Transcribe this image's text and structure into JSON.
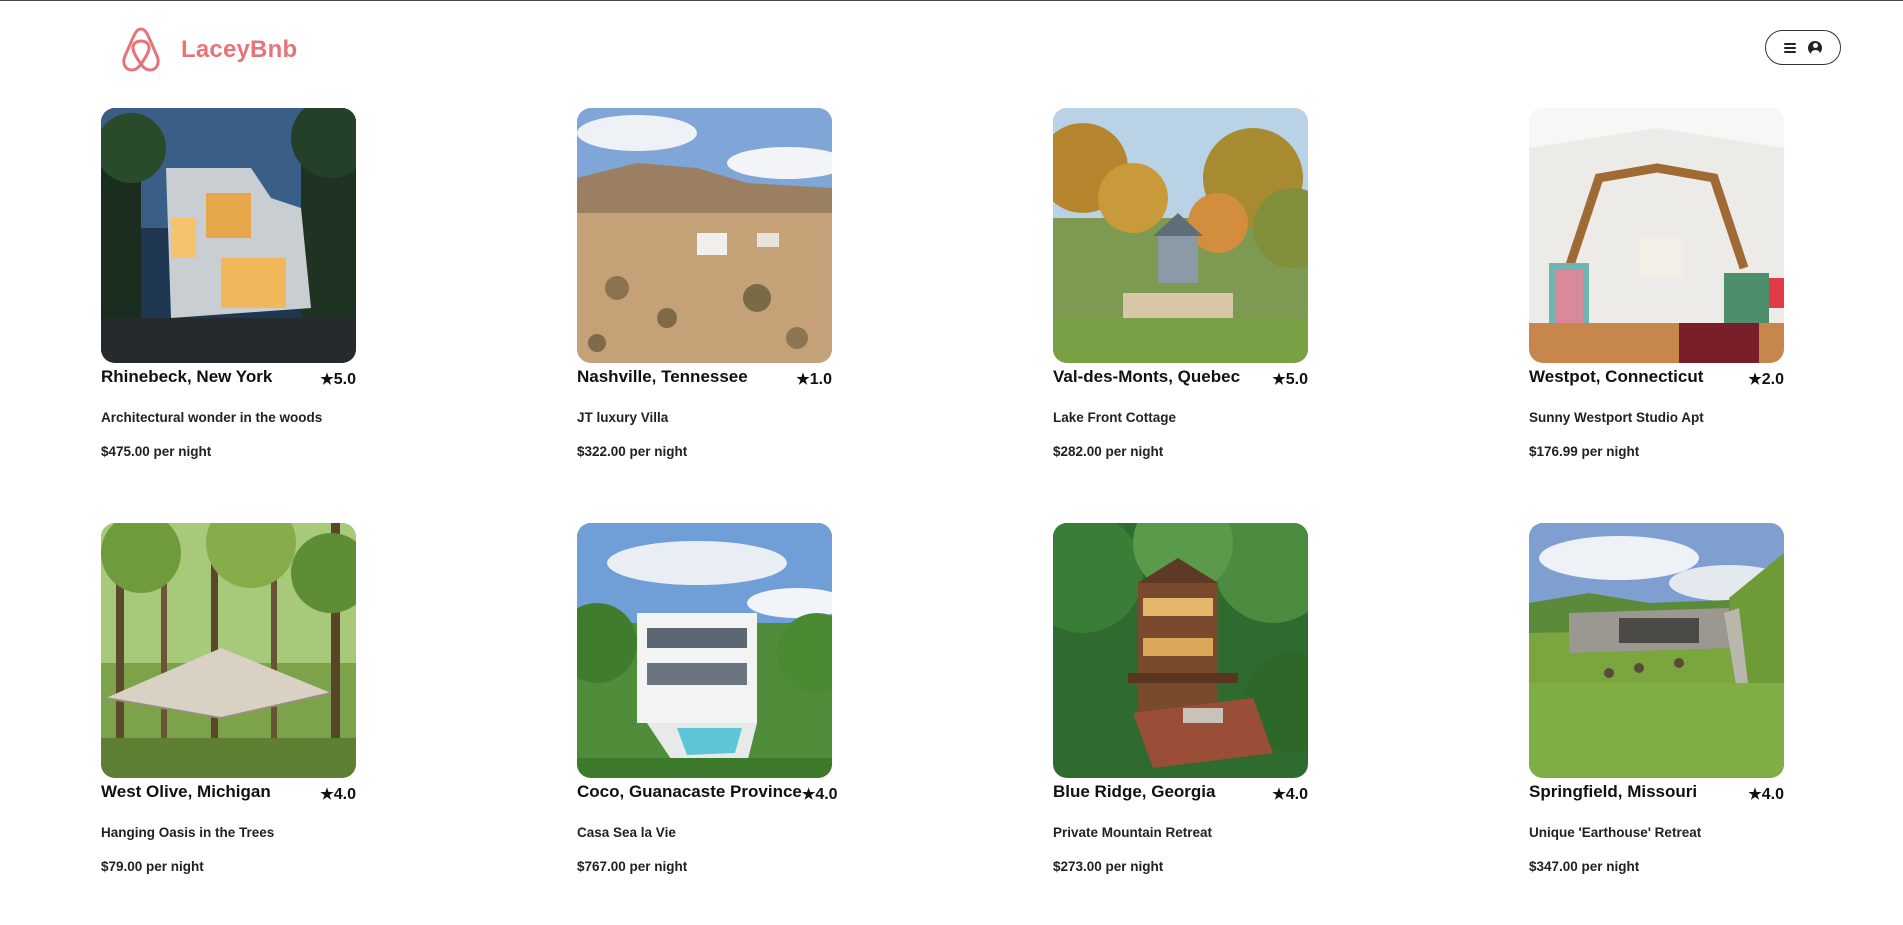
{
  "app": {
    "name": "LaceyBnb",
    "brand_color": "#e57579"
  },
  "header": {
    "logo_icon": "airbnb-logo-icon",
    "profile_menu_icons": [
      "hamburger-menu-icon",
      "user-circle-icon"
    ]
  },
  "listings": [
    {
      "location": "Rhinebeck, New York",
      "rating": "5.0",
      "title": "Architectural wonder in the woods",
      "price": "$475.00 per night"
    },
    {
      "location": "Nashville, Tennessee",
      "rating": "1.0",
      "title": "JT luxury Villa",
      "price": "$322.00 per night"
    },
    {
      "location": "Val-des-Monts, Quebec",
      "rating": "5.0",
      "title": "Lake Front Cottage",
      "price": "$282.00 per night"
    },
    {
      "location": "Westpot, Connecticut",
      "rating": "2.0",
      "title": "Sunny Westport Studio Apt",
      "price": "$176.99 per night"
    },
    {
      "location": "West Olive, Michigan",
      "rating": "4.0",
      "title": "Hanging Oasis in the Trees",
      "price": "$79.00 per night"
    },
    {
      "location": "Coco, Guanacaste Province",
      "rating": "4.0",
      "title": "Casa Sea la Vie",
      "price": "$767.00 per night"
    },
    {
      "location": "Blue Ridge, Georgia",
      "rating": "4.0",
      "title": "Private Mountain Retreat",
      "price": "$273.00 per night"
    },
    {
      "location": "Springfield, Missouri",
      "rating": "4.0",
      "title": "Unique 'Earthouse' Retreat",
      "price": "$347.00 per night"
    }
  ],
  "star_glyph": "★"
}
